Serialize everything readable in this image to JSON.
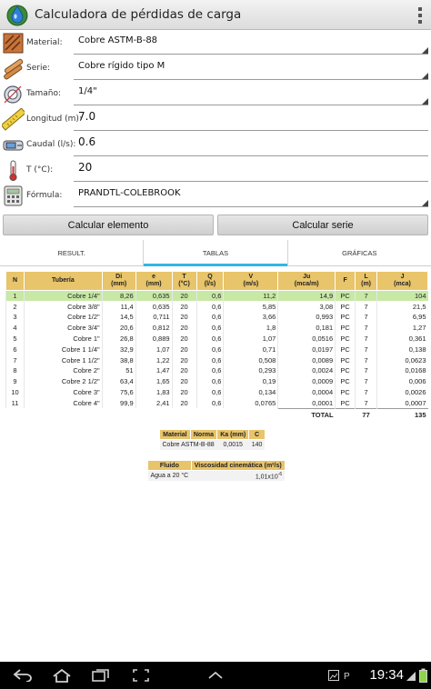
{
  "app": {
    "title": "Calculadora de pérdidas de carga"
  },
  "form": {
    "material": {
      "label": "Material:",
      "value": "Cobre ASTM-B-88"
    },
    "serie": {
      "label": "Serie:",
      "value": "Cobre rígido tipo M"
    },
    "tamano": {
      "label": "Tamaño:",
      "value": "1/4\""
    },
    "longitud": {
      "label": "Longitud (m):",
      "value": "7.0"
    },
    "caudal": {
      "label": "Caudal (l/s):",
      "value": "0.6"
    },
    "temperatura": {
      "label": "T (°C):",
      "value": "20"
    },
    "formula": {
      "label": "Fórmula:",
      "value": "PRANDTL-COLEBROOK"
    }
  },
  "buttons": {
    "calc_elemento": "Calcular elemento",
    "calc_serie": "Calcular serie"
  },
  "tabs": [
    {
      "label": "RESULT."
    },
    {
      "label": "TABLAS"
    },
    {
      "label": "GRÁFICAS"
    }
  ],
  "results": {
    "headers": [
      {
        "top": "N",
        "unit": ""
      },
      {
        "top": "Tubería",
        "unit": ""
      },
      {
        "top": "Di",
        "unit": "(mm)"
      },
      {
        "top": "e",
        "unit": "(mm)"
      },
      {
        "top": "T",
        "unit": "(°C)"
      },
      {
        "top": "Q",
        "unit": "(l/s)"
      },
      {
        "top": "V",
        "unit": "(m/s)"
      },
      {
        "top": "Ju",
        "unit": "(mca/m)"
      },
      {
        "top": "F",
        "unit": ""
      },
      {
        "top": "L",
        "unit": "(m)"
      },
      {
        "top": "J",
        "unit": "(mca)"
      }
    ],
    "rows": [
      [
        "1",
        "Cobre 1/4\"",
        "8,26",
        "0,635",
        "20",
        "0,6",
        "11,2",
        "14,9",
        "PC",
        "7",
        "104"
      ],
      [
        "2",
        "Cobre 3/8\"",
        "11,4",
        "0,635",
        "20",
        "0,6",
        "5,85",
        "3,08",
        "PC",
        "7",
        "21,5"
      ],
      [
        "3",
        "Cobre 1/2\"",
        "14,5",
        "0,711",
        "20",
        "0,6",
        "3,66",
        "0,993",
        "PC",
        "7",
        "6,95"
      ],
      [
        "4",
        "Cobre 3/4\"",
        "20,6",
        "0,812",
        "20",
        "0,6",
        "1,8",
        "0,181",
        "PC",
        "7",
        "1,27"
      ],
      [
        "5",
        "Cobre 1\"",
        "26,8",
        "0,889",
        "20",
        "0,6",
        "1,07",
        "0,0516",
        "PC",
        "7",
        "0,361"
      ],
      [
        "6",
        "Cobre 1 1/4\"",
        "32,9",
        "1,07",
        "20",
        "0,6",
        "0,71",
        "0,0197",
        "PC",
        "7",
        "0,138"
      ],
      [
        "7",
        "Cobre 1 1/2\"",
        "38,8",
        "1,22",
        "20",
        "0,6",
        "0,508",
        "0,0089",
        "PC",
        "7",
        "0,0623"
      ],
      [
        "8",
        "Cobre 2\"",
        "51",
        "1,47",
        "20",
        "0,6",
        "0,293",
        "0,0024",
        "PC",
        "7",
        "0,0168"
      ],
      [
        "9",
        "Cobre 2 1/2\"",
        "63,4",
        "1,65",
        "20",
        "0,6",
        "0,19",
        "0,0009",
        "PC",
        "7",
        "0,006"
      ],
      [
        "10",
        "Cobre 3\"",
        "75,6",
        "1,83",
        "20",
        "0,6",
        "0,134",
        "0,0004",
        "PC",
        "7",
        "0,0026"
      ],
      [
        "11",
        "Cobre 4\"",
        "99,9",
        "2,41",
        "20",
        "0,6",
        "0,0765",
        "0,0001",
        "PC",
        "7",
        "0,0007"
      ]
    ],
    "total": {
      "label": "TOTAL",
      "l": "77",
      "j": "135"
    }
  },
  "material_table": {
    "headers": [
      "Material",
      "Norma",
      "Ka (mm)",
      "C"
    ],
    "row": [
      "Cobre ASTM-B-88",
      "",
      "0,0015",
      "140"
    ]
  },
  "fluid_table": {
    "headers": [
      "Fluido",
      "Viscosidad cinemática (m²/s)"
    ],
    "fluid": "Agua a 20 °C",
    "viscosity_mantissa": "1,01x10",
    "viscosity_exponent": "-6"
  },
  "status": {
    "time": "19:34"
  },
  "colors": {
    "header": "#e8c46a",
    "selected_row": "#c8e8a6",
    "tab_indicator": "#33b5e5"
  }
}
